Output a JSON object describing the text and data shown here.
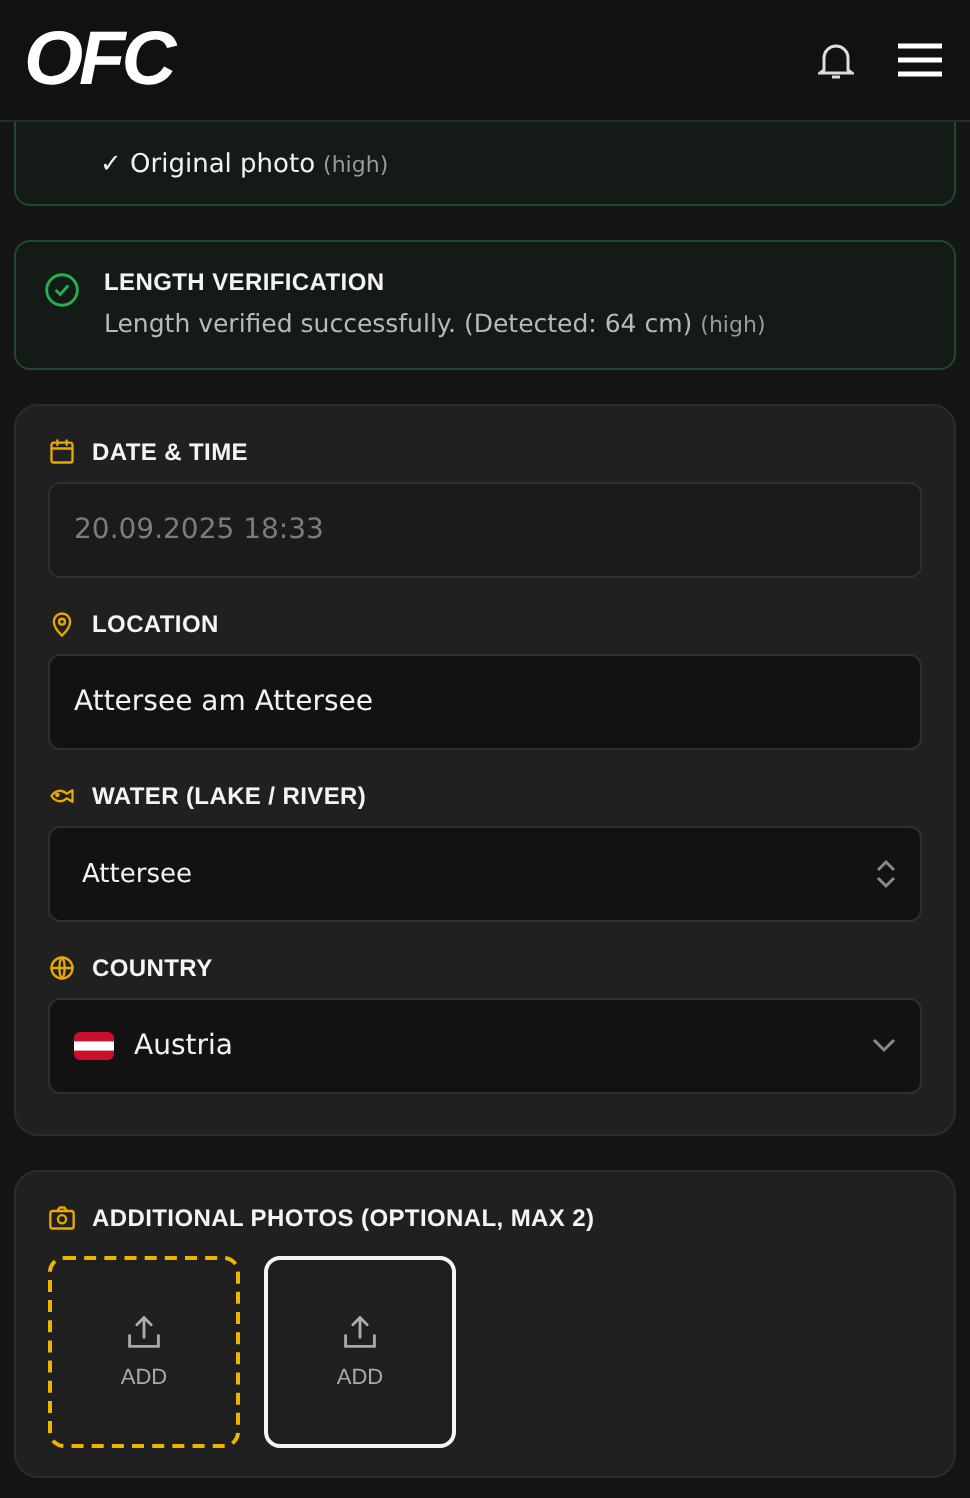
{
  "header": {
    "logo": "OFC"
  },
  "checks_card": {
    "items": [
      {
        "mark": "✓",
        "text": "Original photo",
        "confidence": "(high)"
      }
    ]
  },
  "length_card": {
    "title": "LENGTH VERIFICATION",
    "message": "Length verified successfully. (Detected: 64 cm)",
    "confidence": "(high)",
    "verified": true
  },
  "form": {
    "fields": [
      {
        "kind": "date",
        "label": "DATE & TIME",
        "value": "20.09.2025 18:33",
        "disabled": true
      },
      {
        "kind": "location",
        "label": "LOCATION",
        "value": "Attersee am Attersee",
        "disabled": false
      },
      {
        "kind": "water",
        "label": "WATER (LAKE / RIVER)",
        "value": "Attersee",
        "disabled": false
      },
      {
        "kind": "country",
        "label": "COUNTRY",
        "value": "Austria",
        "disabled": false
      }
    ]
  },
  "photos": {
    "title": "ADDITIONAL PHOTOS (OPTIONAL, MAX 2)",
    "slots": [
      {
        "label": "ADD",
        "selected": true
      },
      {
        "label": "ADD",
        "selected": false
      }
    ]
  }
}
